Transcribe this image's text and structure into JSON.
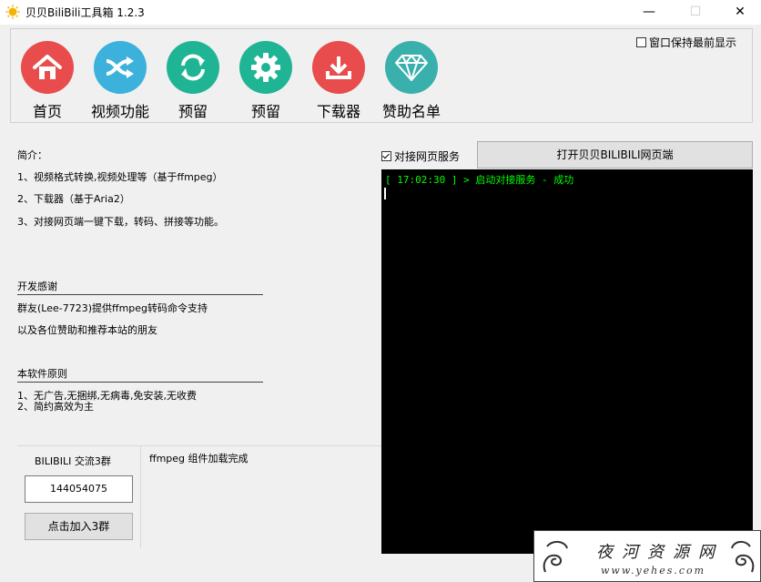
{
  "window": {
    "title": "贝贝BiliBili工具箱 1.2.3",
    "minimize_glyph": "—",
    "maximize_glyph": "☐",
    "close_glyph": "✕"
  },
  "toolbar": {
    "items": [
      {
        "label": "首页",
        "icon": "home-icon",
        "color": "#e84c4c"
      },
      {
        "label": "视频功能",
        "icon": "shuffle-icon",
        "color": "#3bb1dc"
      },
      {
        "label": "预留",
        "icon": "refresh-icon",
        "color": "#1fb594"
      },
      {
        "label": "预留",
        "icon": "gear-icon",
        "color": "#1fb594"
      },
      {
        "label": "下载器",
        "icon": "download-icon",
        "color": "#e84c4c"
      },
      {
        "label": "赞助名单",
        "icon": "diamond-icon",
        "color": "#3ab0ad"
      }
    ],
    "always_on_top_label": "窗口保持最前显示",
    "always_on_top_checked": false
  },
  "intro": {
    "heading": "简介：",
    "lines": [
      "1、视频格式转换,视频处理等（基于ffmpeg）",
      "2、下载器（基于Aria2）",
      "3、对接网页端一键下载，转码、拼接等功能。"
    ]
  },
  "thanks": {
    "heading": "开发感谢",
    "lines": [
      "群友(Lee-7723)提供ffmpeg转码命令支持",
      "以及各位赞助和推荐本站的朋友"
    ]
  },
  "principles": {
    "heading": "本软件原则",
    "lines": [
      "1、无广告,无捆绑,无病毒,免安装,无收费",
      "2、简约高效为主"
    ]
  },
  "group": {
    "title": "BILIBILI 交流3群",
    "number": "144054075",
    "join_label": "点击加入3群"
  },
  "status": {
    "text": "ffmpeg 组件加载完成"
  },
  "service": {
    "label": "对接网页服务",
    "checked": true,
    "open_button_label": "打开贝贝BILIBILI网页端",
    "log": "[ 17:02:30 ] > 启动对接服务 - 成功"
  },
  "watermark": {
    "title": "夜河资源网",
    "url": "www.yehes.com"
  }
}
